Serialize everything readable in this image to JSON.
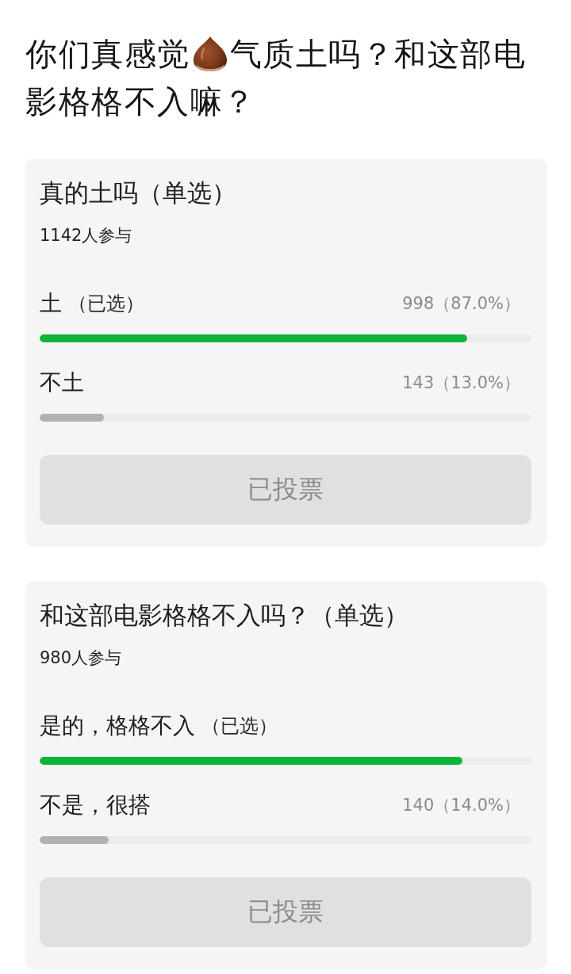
{
  "title": {
    "lines": [
      [
        {
          "kind": "text",
          "text": "你们真感觉"
        },
        {
          "kind": "chestnut"
        },
        {
          "kind": "text",
          "text": "气质土吗？和这部电"
        }
      ],
      [
        {
          "kind": "text",
          "text": "影格格不入嘛？"
        }
      ]
    ]
  },
  "polls": [
    {
      "title": "真的土吗（单选）",
      "participants": "1142人参与",
      "options": [
        {
          "label": "土",
          "note": "（已选）",
          "selected": true,
          "reading": "998（87.0%）",
          "level": 0.87
        },
        {
          "label": "不土",
          "selected": false,
          "reading": "143（13.0%）",
          "level": 0.13
        }
      ],
      "button": {
        "label": "已投票",
        "disabled": true
      }
    },
    {
      "title": "和这部电影格格不入吗？（单选）",
      "participants": "980人参与",
      "options": [
        {
          "label": "是的，格格不入",
          "note": "（已选）",
          "selected": true,
          "level": 0.86
        },
        {
          "label": "不是，很搭",
          "selected": false,
          "reading": "140（14.0%）",
          "level": 0.14
        }
      ],
      "button": {
        "label": "已投票",
        "disabled": true
      }
    }
  ]
}
